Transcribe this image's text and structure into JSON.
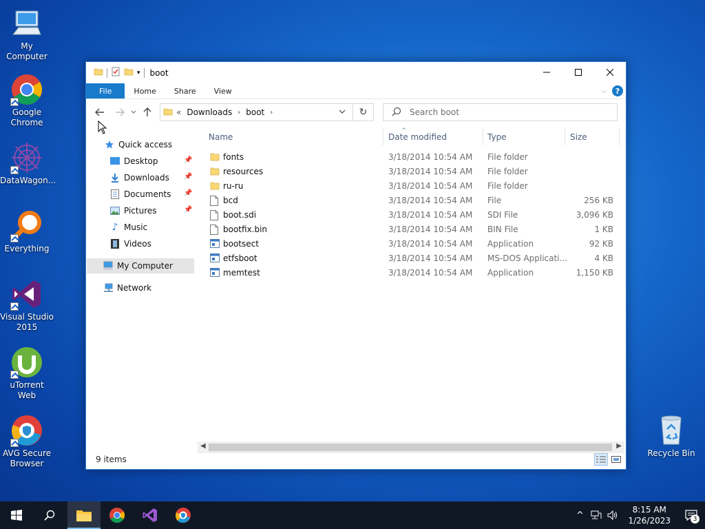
{
  "desktop": {
    "icons": [
      {
        "label": "My Computer"
      },
      {
        "label": "Google Chrome"
      },
      {
        "label": "DataWagon..."
      },
      {
        "label": "Everything"
      },
      {
        "label": "Visual Studio 2015"
      },
      {
        "label": "uTorrent Web"
      },
      {
        "label": "AVG Secure Browser"
      },
      {
        "label": "Recycle Bin"
      }
    ]
  },
  "window": {
    "title": "boot",
    "ribbon_tabs": [
      "File",
      "Home",
      "Share",
      "View"
    ],
    "help_label": "?",
    "address": {
      "root_chev": "«",
      "crumbs": [
        "Downloads",
        "boot"
      ]
    },
    "search_placeholder": "Search boot",
    "nav": {
      "quick_access": "Quick access",
      "items": [
        "Desktop",
        "Downloads",
        "Documents",
        "Pictures",
        "Music",
        "Videos"
      ],
      "my_computer": "My Computer",
      "network": "Network"
    },
    "columns": {
      "name": "Name",
      "date": "Date modified",
      "type": "Type",
      "size": "Size"
    },
    "files": [
      {
        "name": "fonts",
        "date": "3/18/2014 10:54 AM",
        "type": "File folder",
        "size": "",
        "icon": "folder"
      },
      {
        "name": "resources",
        "date": "3/18/2014 10:54 AM",
        "type": "File folder",
        "size": "",
        "icon": "folder"
      },
      {
        "name": "ru-ru",
        "date": "3/18/2014 10:54 AM",
        "type": "File folder",
        "size": "",
        "icon": "folder"
      },
      {
        "name": "bcd",
        "date": "3/18/2014 10:54 AM",
        "type": "File",
        "size": "256 KB",
        "icon": "file"
      },
      {
        "name": "boot.sdi",
        "date": "3/18/2014 10:54 AM",
        "type": "SDI File",
        "size": "3,096 KB",
        "icon": "file"
      },
      {
        "name": "bootfix.bin",
        "date": "3/18/2014 10:54 AM",
        "type": "BIN File",
        "size": "1 KB",
        "icon": "file"
      },
      {
        "name": "bootsect",
        "date": "3/18/2014 10:54 AM",
        "type": "Application",
        "size": "92 KB",
        "icon": "app"
      },
      {
        "name": "etfsboot",
        "date": "3/18/2014 10:54 AM",
        "type": "MS-DOS Applicati...",
        "size": "4 KB",
        "icon": "app"
      },
      {
        "name": "memtest",
        "date": "3/18/2014 10:54 AM",
        "type": "Application",
        "size": "1,150 KB",
        "icon": "app"
      }
    ],
    "status": "9 items"
  },
  "taskbar": {
    "time": "8:15 AM",
    "date": "1/26/2023",
    "notification_count": "3"
  },
  "colors": {
    "accent": "#1979ca",
    "folder": "#f8d775",
    "taskbar": "#101826"
  }
}
